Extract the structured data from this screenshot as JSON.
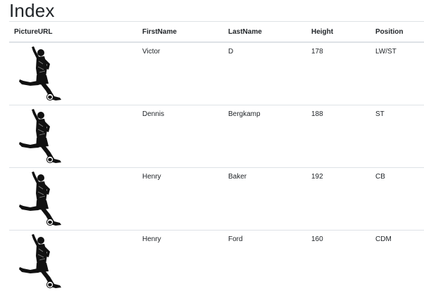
{
  "page": {
    "title": "Index"
  },
  "table": {
    "headers": [
      "PictureURL",
      "FirstName",
      "LastName",
      "Height",
      "Position"
    ],
    "rows": [
      {
        "picture": "soccer-player-icon",
        "first_name": "Victor",
        "last_name": "D",
        "height": "178",
        "position": "LW/ST"
      },
      {
        "picture": "soccer-player-icon",
        "first_name": "Dennis",
        "last_name": "Bergkamp",
        "height": "188",
        "position": "ST"
      },
      {
        "picture": "soccer-player-icon",
        "first_name": "Henry",
        "last_name": "Baker",
        "height": "192",
        "position": "CB"
      },
      {
        "picture": "soccer-player-icon",
        "first_name": "Henry",
        "last_name": "Ford",
        "height": "160",
        "position": "CDM"
      }
    ]
  }
}
